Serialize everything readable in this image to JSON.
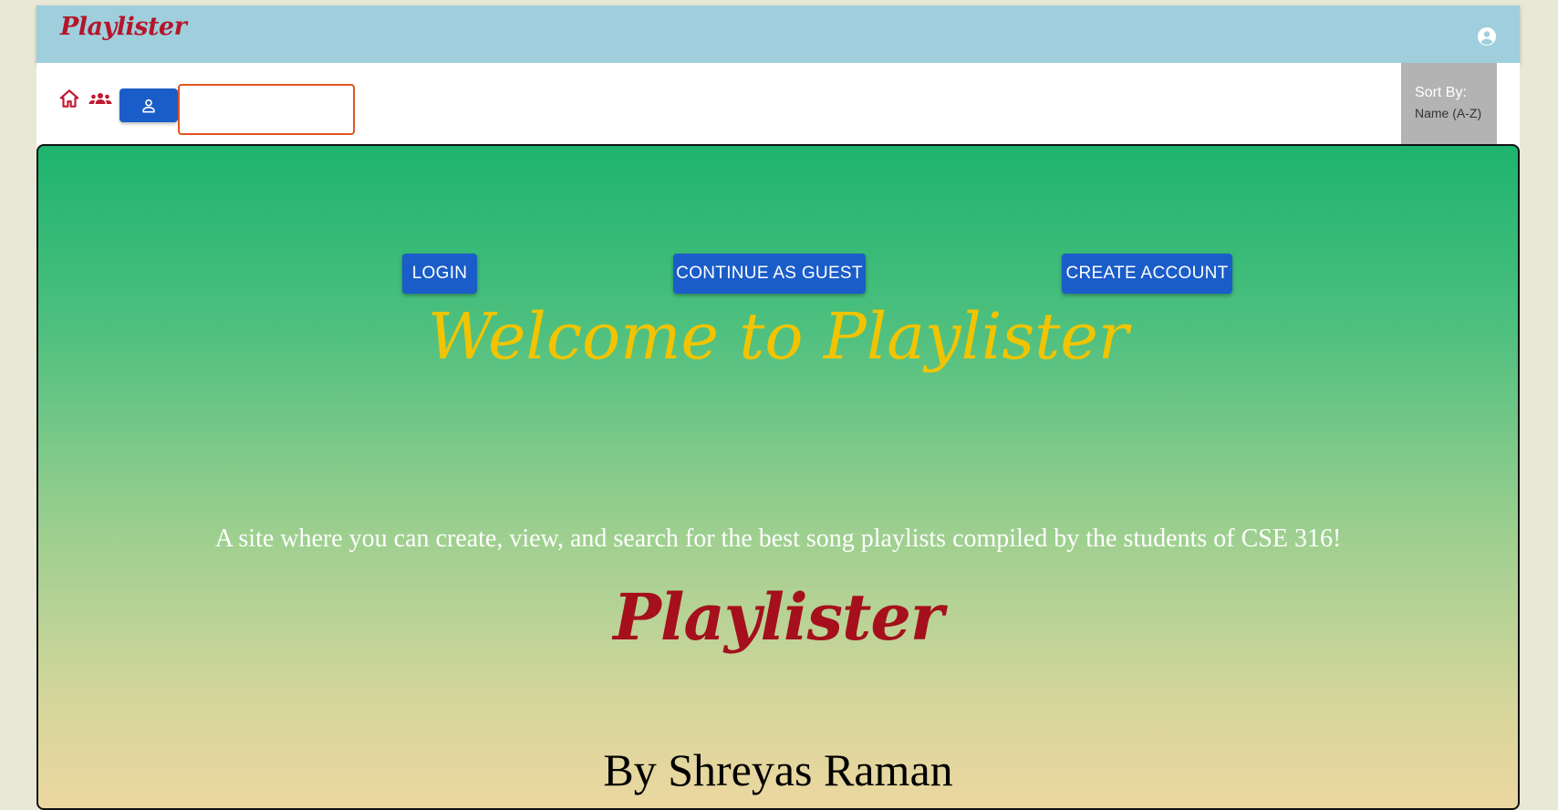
{
  "appbar": {
    "brand": "Playlister",
    "brand_color": "#b3162b",
    "background": "#9fcfdd",
    "account_icon": "account-circle-icon"
  },
  "toolbar": {
    "home_icon": "home-icon",
    "groups_icon": "groups-icon",
    "user_icon": "person-icon",
    "search": {
      "value": "",
      "placeholder": ""
    },
    "sort": {
      "title": "Sort By:",
      "value": "Name (A-Z)"
    }
  },
  "hero": {
    "buttons": {
      "login": "LOGIN",
      "guest": "CONTINUE AS GUEST",
      "create": "CREATE ACCOUNT"
    },
    "welcome": "Welcome to Playlister",
    "tagline": "A site where you can create, view, and search for the best song playlists compiled by the students of CSE 316!",
    "logo": "Playlister",
    "byline": "By Shreyas Raman",
    "accent_color": "#1a5dc9",
    "welcome_color": "#f2c400",
    "logo_color": "#a5101c"
  }
}
